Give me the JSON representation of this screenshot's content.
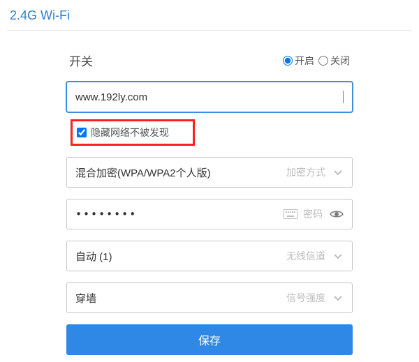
{
  "title": "2.4G Wi-Fi",
  "switch": {
    "label": "开关",
    "on": "开启",
    "off": "关闭",
    "value": "on"
  },
  "ssid": {
    "value": "www.192ly.com"
  },
  "hide_network": {
    "label": "隐藏网络不被发现",
    "checked": true
  },
  "encryption": {
    "value": "混合加密(WPA/WPA2个人版)",
    "hint": "加密方式"
  },
  "password": {
    "masked": "••••••••",
    "hint": "密码"
  },
  "channel": {
    "value": "自动 (1)",
    "hint": "无线信道"
  },
  "signal": {
    "value": "穿墙",
    "hint": "信号强度"
  },
  "save_label": "保存"
}
